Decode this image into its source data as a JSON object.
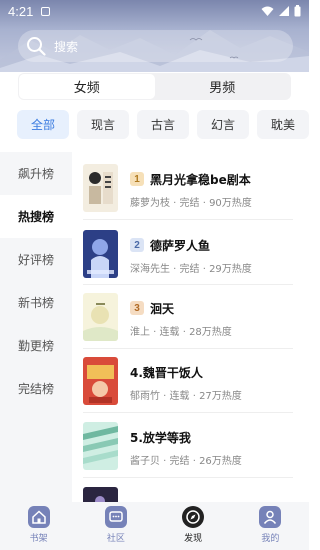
{
  "status_bar": {
    "time": "4:21"
  },
  "search": {
    "placeholder": "搜索"
  },
  "gender_tabs": [
    {
      "label": "女频",
      "active": true
    },
    {
      "label": "男频",
      "active": false
    }
  ],
  "categories": [
    {
      "label": "全部",
      "active": true
    },
    {
      "label": "现言",
      "active": false
    },
    {
      "label": "古言",
      "active": false
    },
    {
      "label": "幻言",
      "active": false
    },
    {
      "label": "耽美",
      "active": false
    }
  ],
  "rank_types": [
    {
      "label": "飙升榜",
      "active": false
    },
    {
      "label": "热搜榜",
      "active": true
    },
    {
      "label": "好评榜",
      "active": false
    },
    {
      "label": "新书榜",
      "active": false
    },
    {
      "label": "勤更榜",
      "active": false
    },
    {
      "label": "完结榜",
      "active": false
    }
  ],
  "books": [
    {
      "rank": "1",
      "title": "黑月光拿稳be剧本",
      "meta": "藤萝为枝 · 完结 · 90万热度"
    },
    {
      "rank": "2",
      "title": "德萨罗人鱼",
      "meta": "深海先生 · 完结 · 29万热度"
    },
    {
      "rank": "3",
      "title": "洄天",
      "meta": "淮上 · 连载 · 28万热度"
    },
    {
      "rank": "",
      "title": "4.魏晋干饭人",
      "meta": "郁雨竹 · 连载 · 27万热度"
    },
    {
      "rank": "",
      "title": "5.放学等我",
      "meta": "酱子贝 · 完结 · 26万热度"
    }
  ],
  "bottom_tabs": [
    {
      "label": "书架",
      "icon": "home-icon",
      "active": false
    },
    {
      "label": "社区",
      "icon": "chat-icon",
      "active": false
    },
    {
      "label": "发现",
      "icon": "compass-icon",
      "active": true
    },
    {
      "label": "我的",
      "icon": "user-icon",
      "active": false
    }
  ],
  "colors": {
    "accent": "#3a7be0",
    "tab_inactive": "#7682b8",
    "header_top": "#7b86ad"
  }
}
